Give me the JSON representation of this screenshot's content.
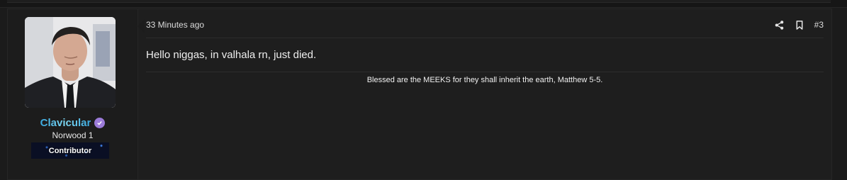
{
  "user": {
    "username": "Clavicular",
    "title": "Norwood 1",
    "banner": "Contributor",
    "verified_icon": "verified-badge-icon",
    "verified_color": "#9b7bd8",
    "username_color": "#5bc7ea"
  },
  "post": {
    "timestamp": "33 Minutes ago",
    "number": "#3",
    "message": "Hello niggas, in valhala rn, just died.",
    "signature": "Blessed are the MEEKS for they shall inherit the earth, Matthew 5-5."
  },
  "actions": {
    "share_icon": "share-icon",
    "bookmark_icon": "bookmark-icon"
  }
}
